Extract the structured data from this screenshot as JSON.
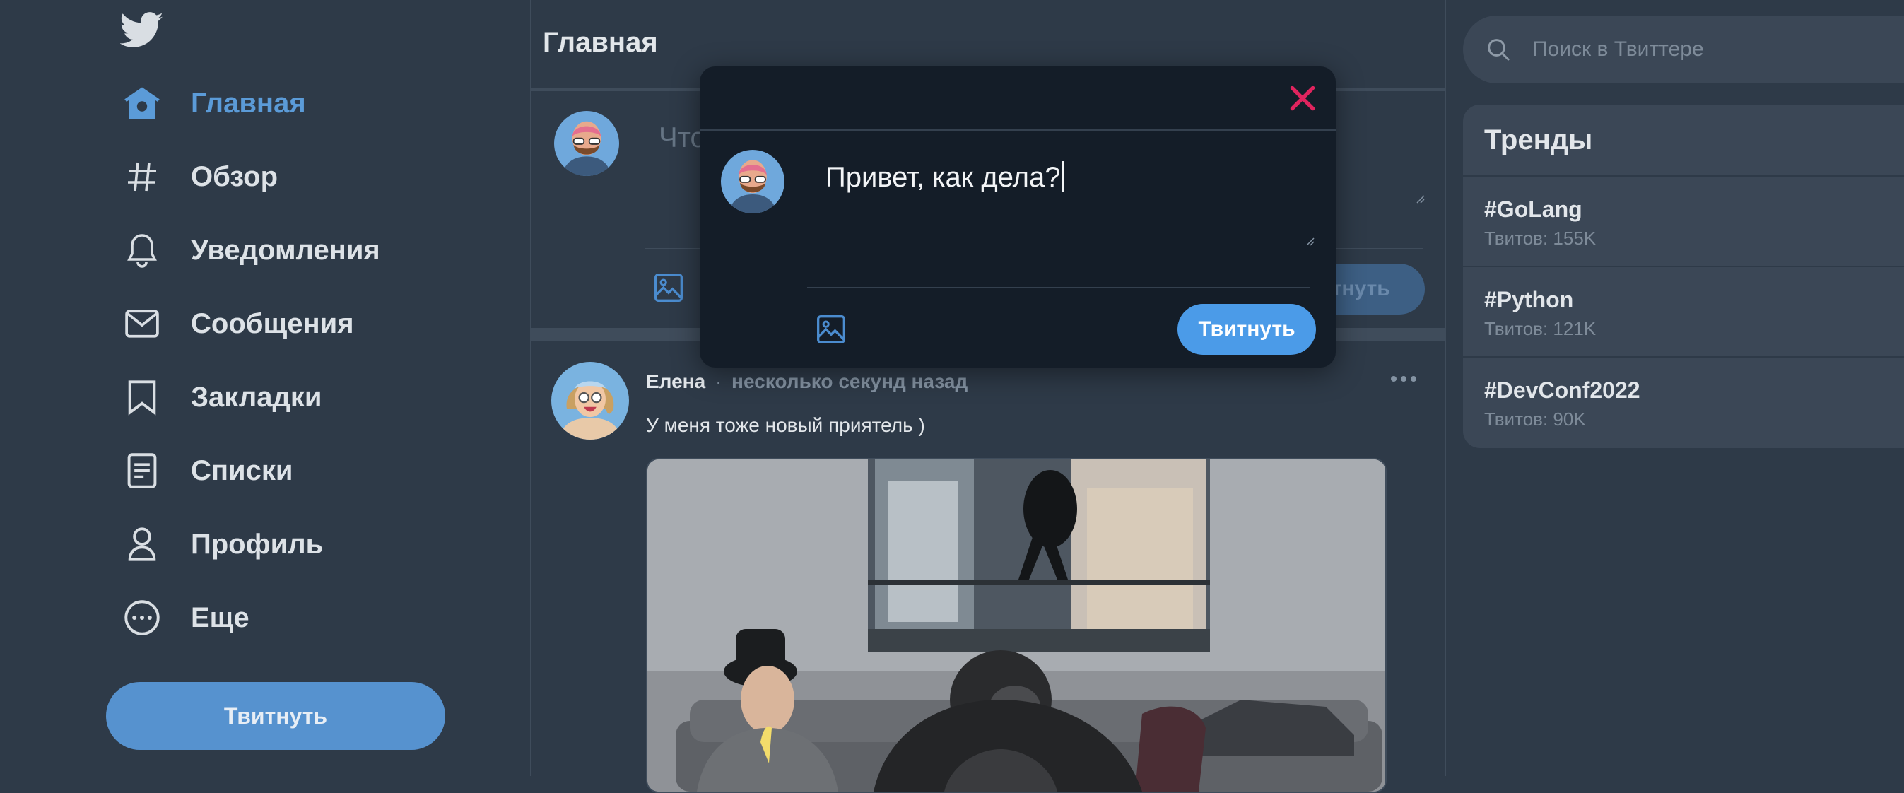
{
  "sidebar": {
    "logo": "twitter-bird-icon",
    "items": [
      {
        "label": "Главная",
        "icon": "home-icon",
        "active": true
      },
      {
        "label": "Обзор",
        "icon": "hashtag-icon"
      },
      {
        "label": "Уведомления",
        "icon": "bell-icon"
      },
      {
        "label": "Сообщения",
        "icon": "envelope-icon"
      },
      {
        "label": "Закладки",
        "icon": "bookmark-icon"
      },
      {
        "label": "Списки",
        "icon": "list-icon"
      },
      {
        "label": "Профиль",
        "icon": "user-icon"
      },
      {
        "label": "Еще",
        "icon": "more-circle-icon"
      }
    ],
    "tweet_button": "Твитнуть"
  },
  "feed": {
    "title": "Главная",
    "compose": {
      "placeholder_visible": "Что",
      "tweet_button_visible": "итнуть"
    },
    "post": {
      "author": "Елена",
      "separator": "·",
      "time": "несколько секунд назад",
      "text": "У меня тоже новый приятель )"
    }
  },
  "search": {
    "placeholder": "Поиск в Твиттере"
  },
  "trends": {
    "title": "Тренды",
    "items": [
      {
        "name": "#GoLang",
        "count": "Твитов: 155K"
      },
      {
        "name": "#Python",
        "count": "Твитов: 121K"
      },
      {
        "name": "#DevConf2022",
        "count": "Твитов: 90K"
      }
    ]
  },
  "modal": {
    "text": "Привет, как дела?",
    "tweet_button": "Твитнуть"
  },
  "colors": {
    "background": "#2e3a48",
    "accent": "#5b9bd8",
    "modal_bg": "#141d28",
    "close": "#e0245e",
    "button": "#4b9be8"
  }
}
